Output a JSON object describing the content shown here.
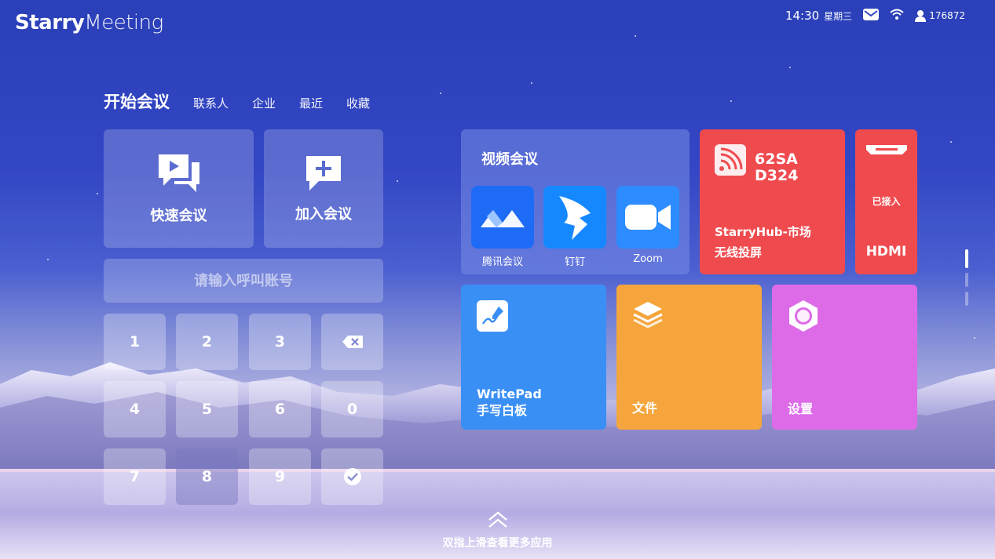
{
  "brand": {
    "bold": "Starry",
    "light": "Meeting"
  },
  "status": {
    "time": "14:30",
    "weekday": "星期三",
    "user_id": "176872"
  },
  "tabs": {
    "main": "开始会议",
    "items": [
      "联系人",
      "企业",
      "最近",
      "收藏"
    ]
  },
  "quick": {
    "quick_meeting": "快速会议",
    "join_meeting": "加入会议"
  },
  "dial": {
    "placeholder": "请输入呼叫账号",
    "keys": [
      "1",
      "2",
      "3",
      "4",
      "5",
      "6",
      "0",
      "7",
      "8",
      "9"
    ]
  },
  "video": {
    "title": "视频会议",
    "apps": [
      {
        "label": "腾讯会议",
        "icon": "tencent-meeting-icon",
        "color": "#1e6cf5"
      },
      {
        "label": "钉钉",
        "icon": "dingtalk-icon",
        "color": "#1688ff"
      },
      {
        "label": "Zoom",
        "icon": "zoom-icon",
        "color": "#2d8cff"
      }
    ]
  },
  "cast": {
    "device": "62SA D324",
    "line1": "StarryHub-市场",
    "line2": "无线投屏",
    "color": "#ef4b4f"
  },
  "hdmi": {
    "status": "已接入",
    "label": "HDMI",
    "color": "#ef4b4f"
  },
  "writepad": {
    "line1": "WritePad",
    "line2": "手写白板",
    "color": "#3a8ff5"
  },
  "files": {
    "label": "文件",
    "color": "#f5a53b"
  },
  "settings": {
    "label": "设置",
    "color": "#dd6be8"
  },
  "footer": {
    "hint": "双指上滑查看更多应用"
  }
}
